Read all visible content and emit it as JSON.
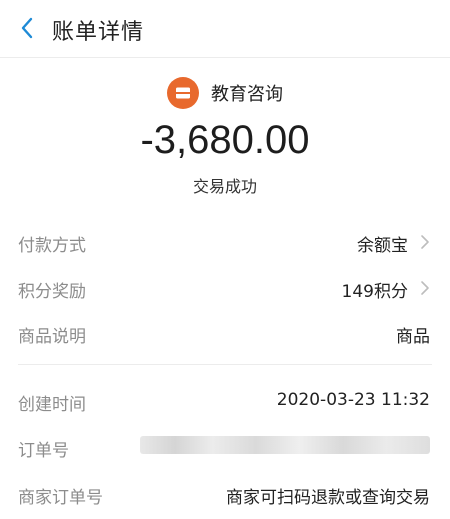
{
  "header": {
    "title": "账单详情"
  },
  "merchant": {
    "name": "教育咨询",
    "icon": "shop-icon",
    "icon_color": "#e8692d"
  },
  "transaction": {
    "amount": "-3,680.00",
    "status": "交易成功"
  },
  "details": [
    {
      "label": "付款方式",
      "value": "余额宝",
      "has_arrow": true
    },
    {
      "label": "积分奖励",
      "value": "149积分",
      "has_arrow": true
    },
    {
      "label": "商品说明",
      "value": "商品",
      "has_arrow": false
    },
    {
      "label": "创建时间",
      "value": "2020-03-23 11:32",
      "has_arrow": false
    },
    {
      "label": "订单号",
      "value": "",
      "has_arrow": false
    },
    {
      "label": "商家订单号",
      "value": "商家可扫码退款或查询交易",
      "has_arrow": false
    }
  ],
  "colors": {
    "accent": "#1e8ad6",
    "merchant_icon": "#e8692d",
    "label": "#8c8c8c"
  }
}
